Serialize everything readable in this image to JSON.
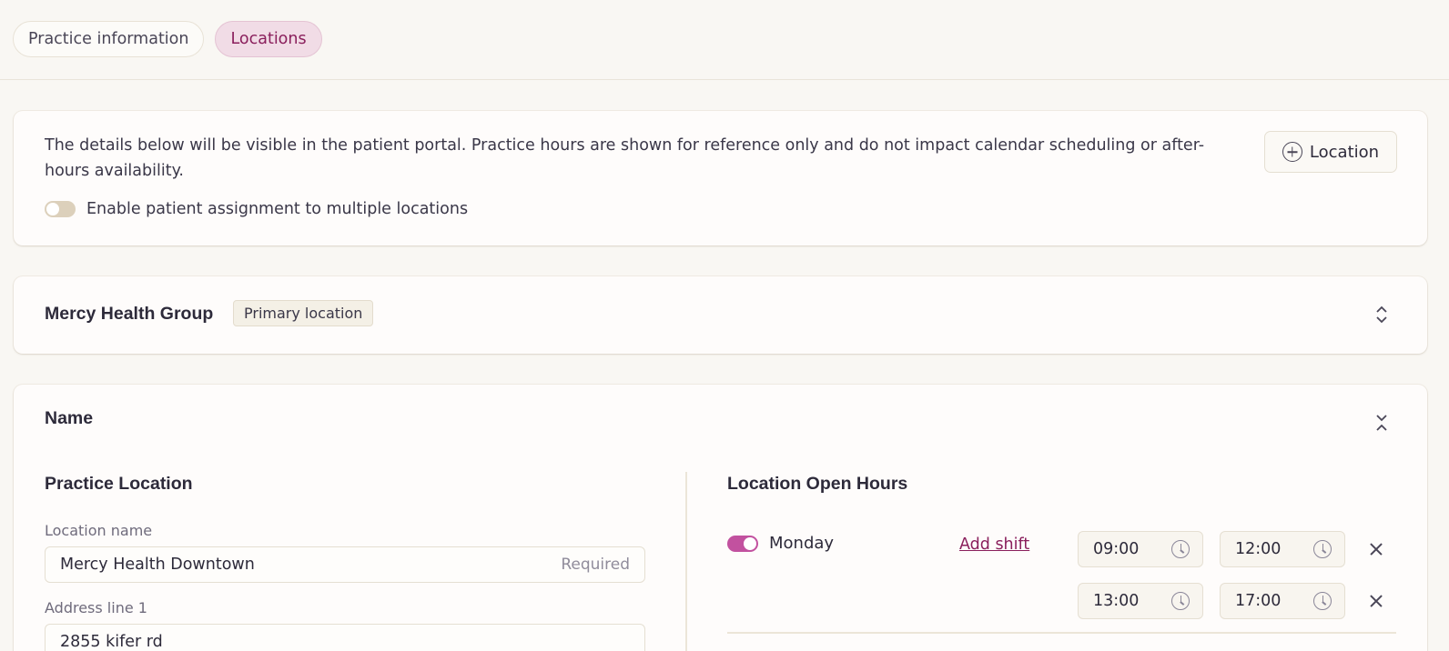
{
  "tabs": [
    {
      "label": "Practice information",
      "active": false
    },
    {
      "label": "Locations",
      "active": true
    }
  ],
  "info": {
    "text": "The details below will be visible in the patient portal. Practice hours are shown for reference only and do not impact calendar scheduling or after-hours availability.",
    "add_location_label": "Location",
    "multi_location_toggle_label": "Enable patient assignment to multiple locations",
    "multi_location_enabled": false
  },
  "group": {
    "title": "Mercy Health Group",
    "badge": "Primary location"
  },
  "location": {
    "header": "Name",
    "practice_section_title": "Practice Location",
    "fields": {
      "location_name_label": "Location name",
      "location_name_value": "Mercy Health Downtown",
      "location_name_hint": "Required",
      "address1_label": "Address line 1",
      "address1_value": "2855 kifer rd"
    },
    "hours_section_title": "Location Open Hours",
    "hours": {
      "day": "Monday",
      "enabled": true,
      "add_shift_label": "Add shift",
      "shifts": [
        {
          "start": "09:00",
          "end": "12:00"
        },
        {
          "start": "13:00",
          "end": "17:00"
        }
      ]
    }
  },
  "colors": {
    "accent": "#8a1f5c",
    "toggle_on": "#c2519f",
    "toggle_off": "#dcd0bb",
    "background": "#f9f7f3"
  }
}
